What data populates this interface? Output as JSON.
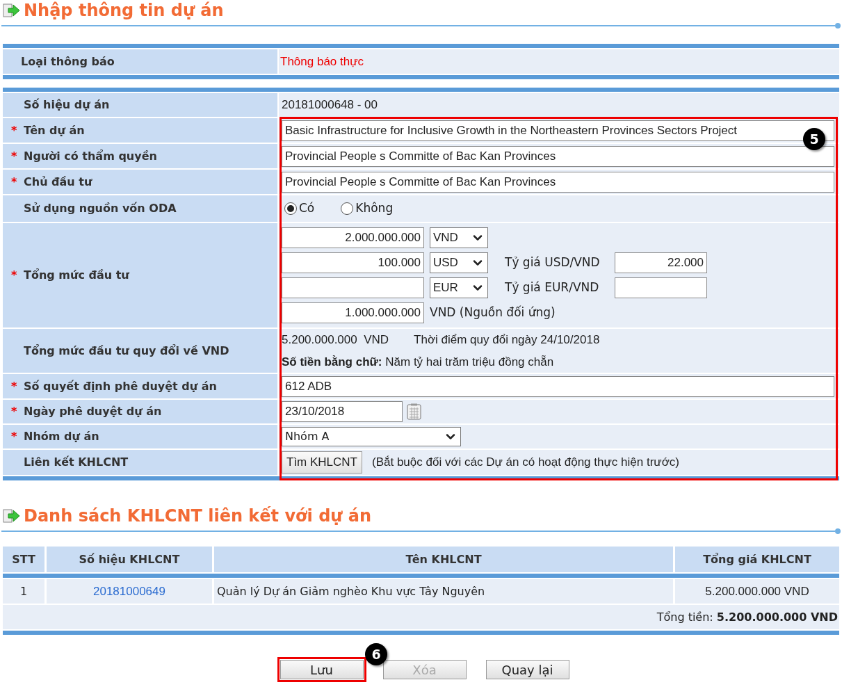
{
  "section_title": "Nhập thông tin dự án",
  "notice": {
    "label": "Loại thông báo",
    "value": "Thông báo thực"
  },
  "fields": [
    {
      "kind": "static",
      "label": "Số hiệu dự án",
      "value": "20181000648 - 00"
    },
    {
      "kind": "input",
      "required_mark": "*",
      "label": "Tên dự án",
      "value": "Basic Infrastructure for Inclusive Growth in the Northeastern Provinces Sectors Project"
    },
    {
      "kind": "input",
      "required_mark": "*",
      "label": "Người có thẩm quyền",
      "value": "Provincial People s Committe of Bac Kan Provinces"
    },
    {
      "kind": "input",
      "required_mark": "*",
      "label": "Chủ đầu tư",
      "value": "Provincial People s Committe of Bac Kan Provinces"
    },
    {
      "kind": "radio",
      "label": "Sử dụng nguồn vốn ODA",
      "options": [
        {
          "label": "Có",
          "selected": true
        },
        {
          "label": "Không",
          "selected": false
        }
      ]
    },
    {
      "kind": "amounts",
      "required_mark": "*",
      "label": "Tổng mức đầu tư",
      "lines": [
        {
          "value": "2.000.000.000",
          "currency": "VND"
        },
        {
          "value": "100.000",
          "currency": "USD",
          "rate_label": "Tỷ giá USD/VND",
          "rate": "22.000"
        },
        {
          "currency": "EUR",
          "rate_label": "Tỷ giá EUR/VND"
        },
        {
          "value": "1.000.000.000",
          "note": "VND (Nguồn đối ứng)"
        }
      ]
    },
    {
      "kind": "converted",
      "label": "Tổng mức đầu tư quy đổi về VND",
      "amount": "5.200.000.000  VND",
      "date_note": "Thời điểm quy đổi ngày 24/10/2018",
      "words": "**Số tiền bằng chữ:** Năm tỷ hai trăm triệu đồng chẵn"
    },
    {
      "kind": "input",
      "required_mark": "*",
      "label": "Số quyết định phê duyệt dự án",
      "value": "612 ADB"
    },
    {
      "kind": "date",
      "required_mark": "*",
      "label": "Ngày phê duyệt dự án",
      "value": "23/10/2018"
    },
    {
      "kind": "select",
      "required_mark": "*",
      "label": "Nhóm dự án",
      "value": "Nhóm A"
    },
    {
      "kind": "link",
      "label": "Liên kết KHLCNT",
      "button": "Tìm KHLCNT",
      "note": "(Bắt buộc đối với các Dự án có hoạt động thực hiện trước)"
    }
  ],
  "form_badge": "5",
  "list_title": "Danh sách KHLCNT liên kết với dự án",
  "table": {
    "columns": [
      "STT",
      "Số hiệu KHLCNT",
      "Tên KHLCNT",
      "Tổng giá KHLCNT"
    ],
    "rows": [
      {
        "stt": "1",
        "code": "20181000649",
        "name": "Quản lý Dự án Giảm nghèo Khu vực Tây Nguyên",
        "total": "5.200.000.000 VND"
      }
    ],
    "sum": "Tổng tiền: **5.200.000.000 VND**"
  },
  "buttons": [
    {
      "label": "Lưu",
      "disabled": false,
      "highlighted": true
    },
    {
      "label": "Xóa",
      "disabled": true,
      "highlighted": false
    },
    {
      "label": "Quay lại",
      "disabled": false,
      "highlighted": false
    }
  ],
  "buttons_badge": "6"
}
